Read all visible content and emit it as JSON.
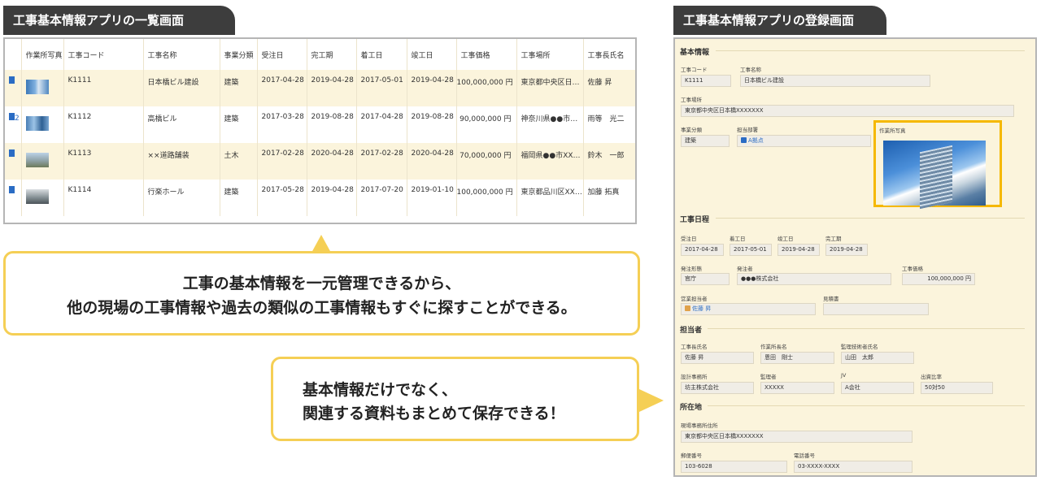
{
  "left_header": "工事基本情報アプリの一覧画面",
  "right_header": "工事基本情報アプリの登録画面",
  "list": {
    "columns": [
      "作業所写真",
      "工事コード",
      "工事名称",
      "事業分類",
      "受注日",
      "完工期",
      "着工日",
      "竣工日",
      "工事価格",
      "工事場所",
      "工事長氏名"
    ],
    "rows": [
      {
        "badge": "",
        "code": "K1111",
        "name": "日本橋ビル建設",
        "category": "建築",
        "order": "2017-04-28",
        "complete": "2019-04-28",
        "start": "2017-05-01",
        "finish": "2019-04-28",
        "price": "100,000,000 円",
        "place": "東京都中央区日…",
        "manager": "佐藤 昇"
      },
      {
        "badge": "2",
        "code": "K1112",
        "name": "高橋ビル",
        "category": "建築",
        "order": "2017-03-28",
        "complete": "2019-08-28",
        "start": "2017-04-28",
        "finish": "2019-08-28",
        "price": "90,000,000 円",
        "place": "神奈川県●●市…",
        "manager": "雨等　光二"
      },
      {
        "badge": "",
        "code": "K1113",
        "name": "××道路舗装",
        "category": "土木",
        "order": "2017-02-28",
        "complete": "2020-04-28",
        "start": "2017-02-28",
        "finish": "2020-04-28",
        "price": "70,000,000 円",
        "place": "福岡県●●市XX…",
        "manager": "鈴木　一郎"
      },
      {
        "badge": "",
        "code": "K1114",
        "name": "行楽ホール",
        "category": "建築",
        "order": "2017-05-28",
        "complete": "2019-04-28",
        "start": "2017-07-20",
        "finish": "2019-01-10",
        "price": "100,000,000 円",
        "place": "東京都品川区XX…",
        "manager": "加藤 拓真"
      }
    ]
  },
  "callout1": {
    "line1": "工事の基本情報を一元管理できるから、",
    "line2": "他の現場の工事情報や過去の類似の工事情報もすぐに探すことができる。"
  },
  "callout2": {
    "line1": "基本情報だけでなく、",
    "line2": "関連する資料もまとめて保存できる！"
  },
  "form": {
    "sec_basic": "基本情報",
    "lbl_code": "工事コード",
    "val_code": "K1111",
    "lbl_name": "工事名称",
    "val_name": "日本橋ビル建設",
    "lbl_place": "工事場所",
    "val_place": "東京都中央区日本橋XXXXXXX",
    "lbl_category": "事業分類",
    "val_category": "建築",
    "lbl_dept": "担当部署",
    "val_dept": "A拠点",
    "lbl_photo": "作業所写真",
    "sec_schedule": "工事日程",
    "lbl_order": "受注日",
    "val_order": "2017-04-28",
    "lbl_start": "着工日",
    "val_start": "2017-05-01",
    "lbl_finish": "竣工日",
    "val_finish": "2019-04-28",
    "lbl_complete": "完工期",
    "val_complete": "2019-04-28",
    "lbl_order_type": "発注形態",
    "val_order_type": "官庁",
    "lbl_client": "発注者",
    "val_client": "●●●株式会社",
    "lbl_price": "工事価格",
    "val_price": "100,000,000 円",
    "lbl_sales": "営業担当者",
    "val_sales": "佐藤 昇",
    "lbl_estimate": "見積書",
    "sec_staff": "担当者",
    "lbl_manager": "工事長氏名",
    "val_manager": "佐藤 昇",
    "lbl_site_chief": "作業所長名",
    "val_site_chief": "恩田　剛士",
    "lbl_supervisor": "監理技術者氏名",
    "val_supervisor": "山田　太郎",
    "lbl_design": "設計事務所",
    "val_design": "坊主株式会社",
    "lbl_inspector": "監理者",
    "val_inspector": "XXXXX",
    "lbl_jv": "JV",
    "val_jv": "A会社",
    "lbl_ratio": "出資比率",
    "val_ratio": "50対50",
    "sec_location": "所在地",
    "lbl_office": "現場事務所住所",
    "val_office": "東京都中央区日本橋XXXXXXX",
    "lbl_zip": "郵便番号",
    "val_zip": "103-6028",
    "lbl_tel": "電話番号",
    "val_tel": "03-XXXX-XXXX"
  },
  "colors": {
    "accent": "#f5cf55",
    "header_bg": "#3d3d3d",
    "row_highlight": "#fbf4dc",
    "photo_border": "#f5b800"
  }
}
